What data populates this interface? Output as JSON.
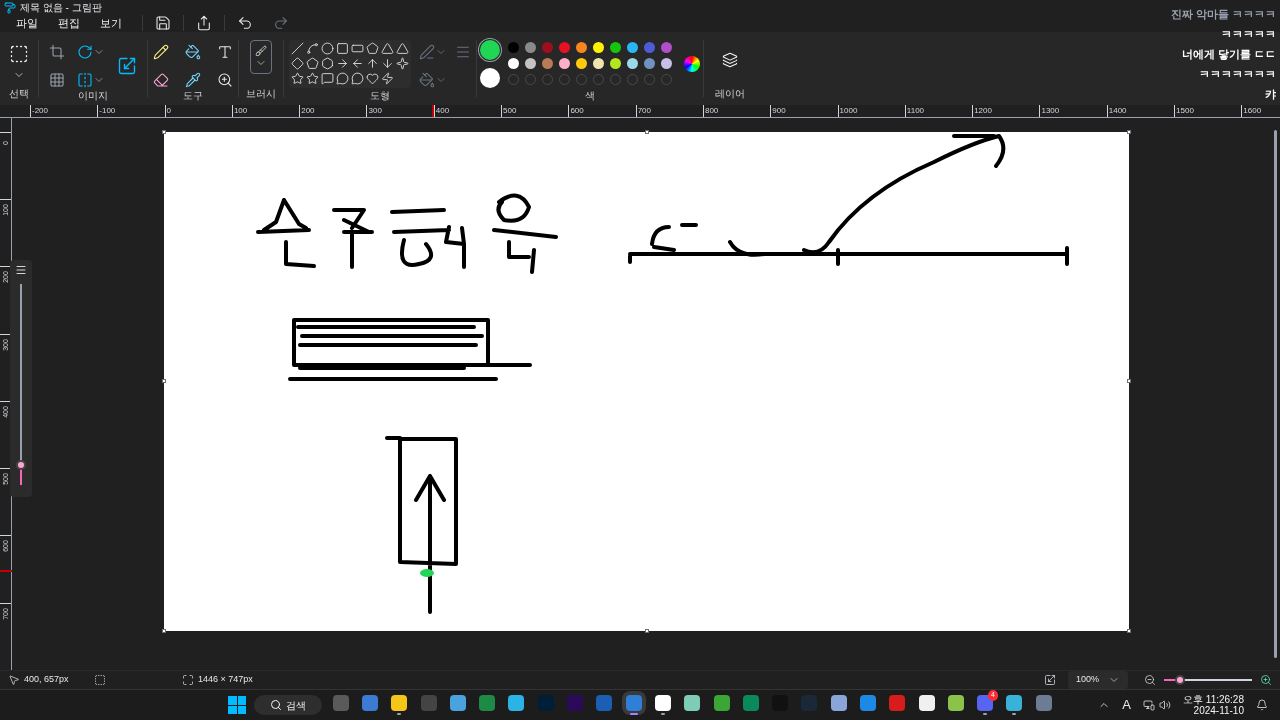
{
  "window": {
    "title": "제목 없음 - 그림판"
  },
  "menu": [
    "파일",
    "편집",
    "보기"
  ],
  "ribbon": {
    "groups": [
      "선택",
      "이미지",
      "도구",
      "브러시",
      "도형",
      "색",
      "레이어"
    ]
  },
  "colors": {
    "current": [
      {
        "color": "#1fd655"
      },
      {
        "color": "#ffffff"
      }
    ],
    "swatches": [
      {
        "color": "#000000"
      },
      {
        "color": "#8a8a8a"
      },
      {
        "color": "#9b0f1f"
      },
      {
        "color": "#e81123"
      },
      {
        "color": "#f7861e"
      },
      {
        "color": "#fff200"
      },
      {
        "color": "#16c60c"
      },
      {
        "color": "#29b6f6"
      },
      {
        "color": "#4e5bd6"
      },
      {
        "color": "#b04fc8"
      },
      {
        "color": "#ffffff"
      },
      {
        "color": "#c3c3c3"
      },
      {
        "color": "#b97a57"
      },
      {
        "color": "#ffaec9"
      },
      {
        "color": "#ffc90e"
      },
      {
        "color": "#efe4b0"
      },
      {
        "color": "#b5e61d"
      },
      {
        "color": "#99d9ea"
      },
      {
        "color": "#7092be"
      },
      {
        "color": "#c8bfe7"
      }
    ]
  },
  "ruler": {
    "horizontal": [
      "-200",
      "-100",
      "0",
      "100",
      "200",
      "300",
      "400",
      "500",
      "600",
      "700",
      "800",
      "900",
      "1000",
      "1100",
      "1200",
      "1300",
      "1400",
      "1500",
      "1600"
    ],
    "vertical": [
      "0",
      "100",
      "200",
      "300",
      "400",
      "500",
      "600",
      "700"
    ]
  },
  "brush_size": {
    "level": 0.1
  },
  "status_bar": {
    "cursor": "400, 657px",
    "canvas_size": "1446 × 747px",
    "zoom": "100%",
    "zoom_slider": {
      "level": 0.18
    }
  },
  "chat": [
    "진짜 악마들 ㅋㅋㅋㅋ",
    "ㅋㅋㅋㅋㅋ",
    "너에게 닿기를 ㄷㄷ",
    "ㅋㅋㅋㅋㅋㅋㅋ",
    "캬"
  ],
  "taskbar": {
    "search": "검색",
    "apps": [
      {
        "running": false,
        "selected": false
      },
      {
        "running": false,
        "selected": false
      },
      {
        "running": true,
        "selected": false
      },
      {
        "running": false,
        "selected": false
      },
      {
        "running": false,
        "selected": false
      },
      {
        "running": false,
        "selected": false
      },
      {
        "running": false,
        "selected": false
      },
      {
        "running": false,
        "selected": false
      },
      {
        "running": false,
        "selected": false
      },
      {
        "running": false,
        "selected": false
      },
      {
        "running": true,
        "selected": true
      },
      {
        "running": true,
        "selected": false
      },
      {
        "running": false,
        "selected": false
      },
      {
        "running": false,
        "selected": false
      },
      {
        "running": false,
        "selected": false
      },
      {
        "running": false,
        "selected": false
      },
      {
        "running": false,
        "selected": false
      },
      {
        "running": false,
        "selected": false
      },
      {
        "running": false,
        "selected": false
      },
      {
        "running": false,
        "selected": false
      },
      {
        "running": false,
        "selected": false
      },
      {
        "running": false,
        "selected": false
      },
      {
        "running": true,
        "selected": false
      },
      {
        "running": true,
        "selected": false
      },
      {
        "running": false,
        "selected": false
      }
    ],
    "badge": "4",
    "input_indicator": "A",
    "time": "오후 11:26:28",
    "date": "2024-11-10"
  }
}
